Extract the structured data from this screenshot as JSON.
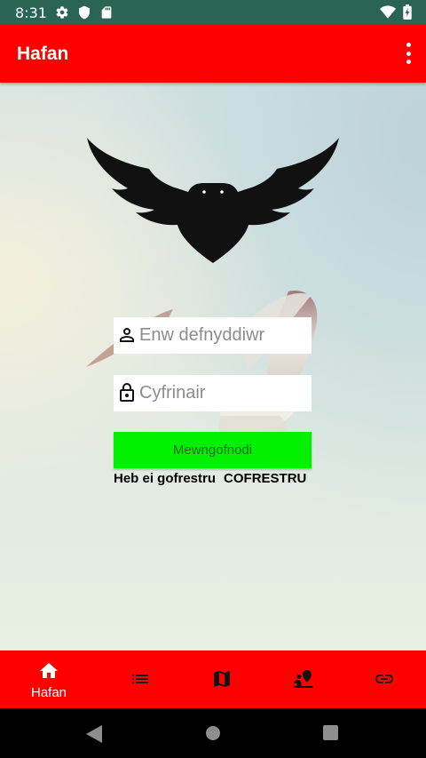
{
  "status_bar": {
    "time": "8:31",
    "left_icons": [
      "gear-icon",
      "shield-icon",
      "sd-card-icon"
    ],
    "right_icons": [
      "wifi-icon",
      "battery-icon"
    ],
    "color": "#2a6455"
  },
  "app_bar": {
    "title": "Hafan",
    "overflow_icon": "more-vert-icon",
    "color": "#ff0000"
  },
  "login": {
    "username_placeholder": "Enw defnyddiwr",
    "username_icon": "person-icon",
    "password_placeholder": "Cyfrinair",
    "password_icon": "lock-icon",
    "button_label": "Mewngofnodi",
    "button_color": "#00f000",
    "register_prompt": "Heb ei gofrestru",
    "register_link": "COFRESTRU"
  },
  "bottom_nav": {
    "items": [
      {
        "icon": "home-icon",
        "label": "Hafan",
        "active": true
      },
      {
        "icon": "list-icon"
      },
      {
        "icon": "map-icon"
      },
      {
        "icon": "person-pin-icon"
      },
      {
        "icon": "link-icon"
      }
    ]
  },
  "system_nav": {
    "icons": [
      "back-icon",
      "home-circle-icon",
      "recents-icon"
    ]
  }
}
